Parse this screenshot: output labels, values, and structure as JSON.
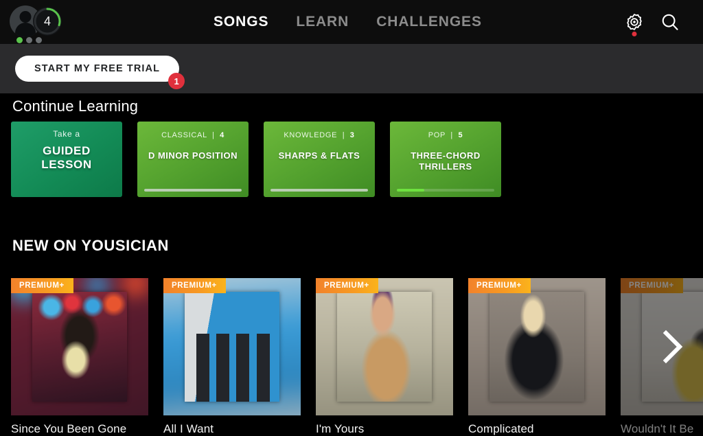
{
  "nav": {
    "level": "4",
    "level_progress_pct": 30,
    "streak_dots": [
      "on",
      "off",
      "off"
    ],
    "links": [
      {
        "label": "SONGS",
        "active": true
      },
      {
        "label": "LEARN",
        "active": false
      },
      {
        "label": "CHALLENGES",
        "active": false
      }
    ],
    "settings_icon": "gear-icon",
    "settings_has_notification": true,
    "search_icon": "search-icon",
    "avatar_icon": "avatar-icon"
  },
  "trial": {
    "label": "START MY FREE TRIAL",
    "badge": "1"
  },
  "continue_learning": {
    "title": "Continue Learning",
    "cards": [
      {
        "kind": "guided",
        "top_prefix": "Take a",
        "top_count": "",
        "name": "GUIDED LESSON",
        "progress_pct": null,
        "progress_style": "none"
      },
      {
        "kind": "lesson",
        "top_prefix": "CLASSICAL",
        "top_count": "4",
        "name": "D MINOR POSITION",
        "progress_pct": 100,
        "progress_style": "dim"
      },
      {
        "kind": "lesson",
        "top_prefix": "KNOWLEDGE",
        "top_count": "3",
        "name": "SHARPS & FLATS",
        "progress_pct": 100,
        "progress_style": "dim"
      },
      {
        "kind": "lesson",
        "top_prefix": "POP",
        "top_count": "5",
        "name": "THREE-CHORD THRILLERS",
        "progress_pct": 28,
        "progress_style": "bright"
      }
    ]
  },
  "new_on_yousician": {
    "title": "NEW ON YOUSICIAN",
    "badge_label": "PREMIUM+",
    "next_arrow_icon": "chevron-right-icon",
    "songs": [
      {
        "title": "Since You Been Gone",
        "art": "rock-guitarist-stage",
        "faded": false
      },
      {
        "title": "All I Want",
        "art": "band-four-members-wall",
        "faded": false
      },
      {
        "title": "I'm Yours",
        "art": "man-hat-acoustic-guitar",
        "faded": false
      },
      {
        "title": "Complicated",
        "art": "blonde-singer-hoodie",
        "faded": false
      },
      {
        "title": "Wouldn't It Be",
        "art": "surfboard-car-beach",
        "faded": true
      }
    ]
  },
  "colors": {
    "accent_green": "#5ac44c",
    "badge_red": "#e0303c",
    "premium_orange": "#f79a22",
    "bg": "#000000",
    "nav_bg": "#0d0d0d",
    "trial_bg": "#2b2b2d"
  }
}
